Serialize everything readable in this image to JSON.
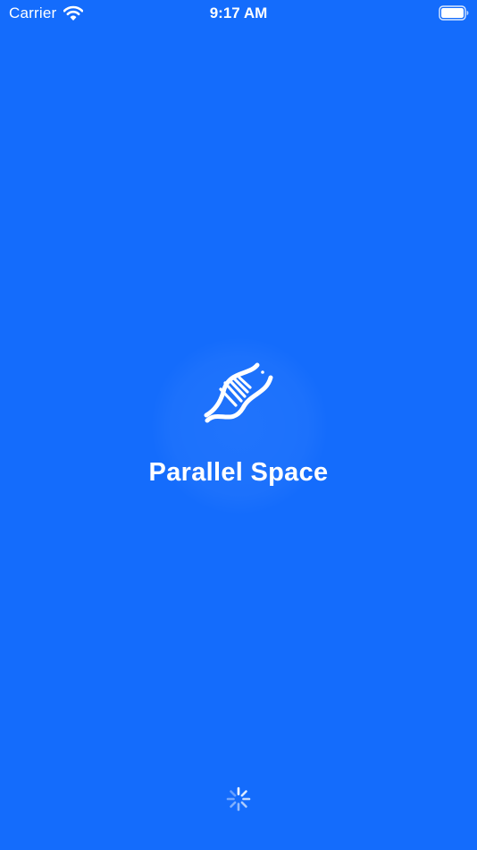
{
  "status_bar": {
    "carrier": "Carrier",
    "time": "9:17 AM",
    "wifi_icon": "wifi-icon",
    "battery_icon": "battery-full-icon"
  },
  "splash": {
    "app_name": "Parallel Space",
    "logo_icon": "dna-helix-icon",
    "loading_icon": "activity-spinner-icon"
  },
  "colors": {
    "background": "#146cfc",
    "foreground": "#ffffff"
  }
}
